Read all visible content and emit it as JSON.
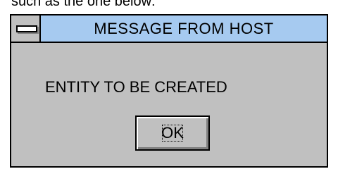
{
  "caption": "such as the one below:",
  "dialog": {
    "title": "MESSAGE FROM HOST",
    "message": "ENTITY TO BE CREATED",
    "ok_label": "OK",
    "system_menu_icon": "system-menu-bar",
    "colors": {
      "titlebar": "#a6caf0",
      "face": "#c0c0c0",
      "border": "#000000"
    }
  }
}
